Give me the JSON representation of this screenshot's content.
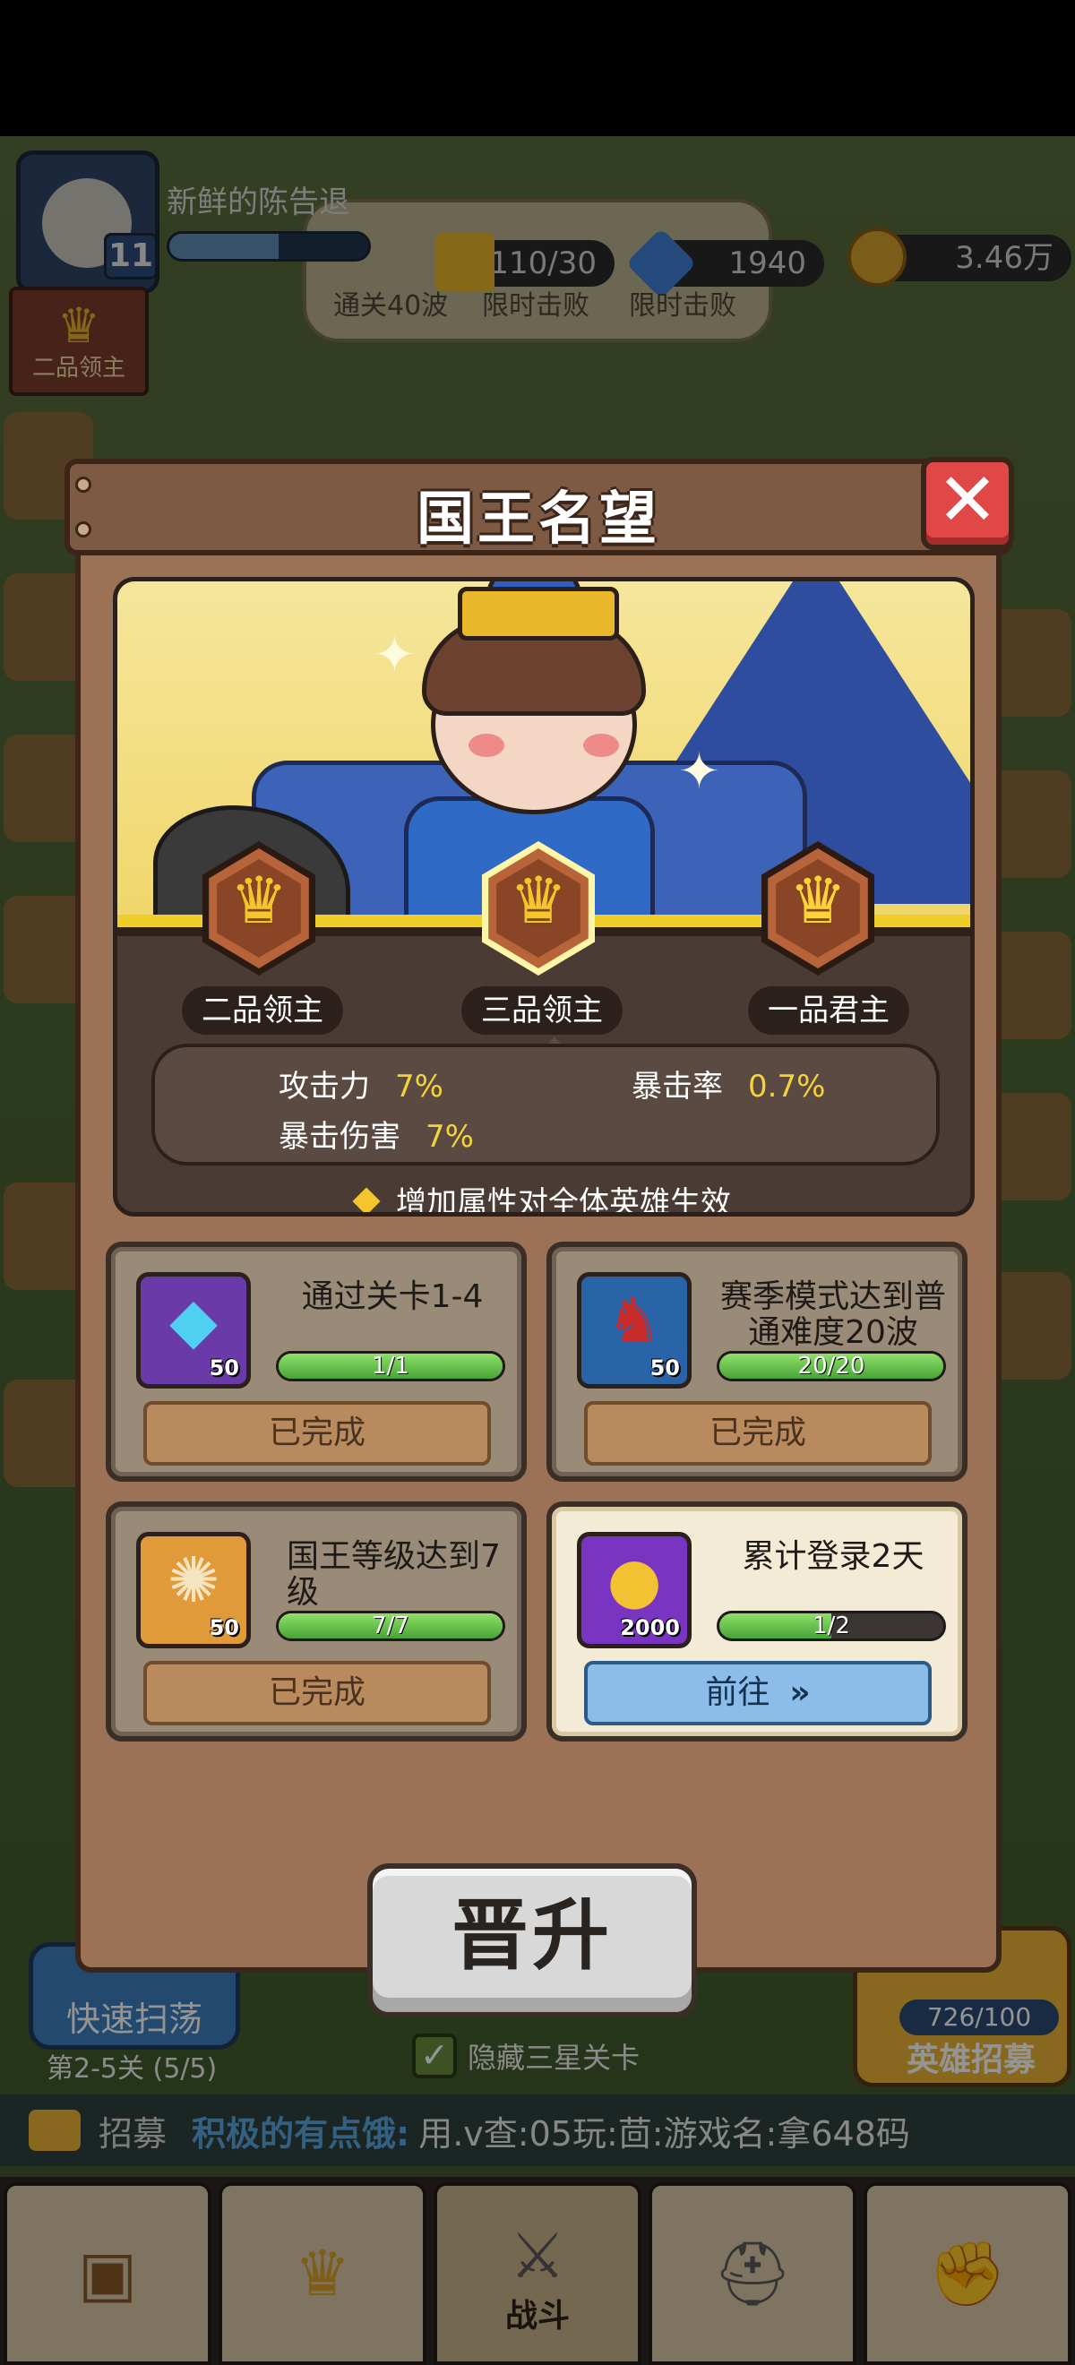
{
  "hud": {
    "player_name": "新鲜的陈告退",
    "level": "11",
    "xp_fraction": 0.55,
    "rank_badge": "二品领主",
    "energy": "110/30",
    "gems": "1940",
    "gold": "3.46万"
  },
  "quests": {
    "items": [
      "通关40波",
      "限时击败",
      "限时击败"
    ]
  },
  "modal": {
    "title": "国王名望",
    "close_symbol": "✕",
    "ranks": [
      {
        "label": "二品领主",
        "active": false
      },
      {
        "label": "三品领主",
        "active": true
      },
      {
        "label": "一品君主",
        "active": false
      }
    ],
    "stats": [
      {
        "key": "攻击力",
        "value": "7%"
      },
      {
        "key": "暴击率",
        "value": "0.7%"
      },
      {
        "key": "暴击伤害",
        "value": "7%"
      }
    ],
    "note": "增加属性对全体英雄生效",
    "tasks": [
      {
        "title": "通过关卡1-4",
        "reward_qty": "50",
        "progress_text": "1/1",
        "progress": 1.0,
        "button": "已完成",
        "state": "done",
        "icon": "gem-icon"
      },
      {
        "title": "赛季模式达到普通难度20波",
        "reward_qty": "50",
        "progress_text": "20/20",
        "progress": 1.0,
        "button": "已完成",
        "state": "done",
        "icon": "devil-icon"
      },
      {
        "title": "国王等级达到7级",
        "reward_qty": "50",
        "progress_text": "7/7",
        "progress": 1.0,
        "button": "已完成",
        "state": "done",
        "icon": "gear-medal-icon"
      },
      {
        "title": "累计登录2天",
        "reward_qty": "2000",
        "progress_text": "1/2",
        "progress": 0.5,
        "button": "前往",
        "state": "go",
        "icon": "gold-coin-icon"
      }
    ],
    "promote_label": "晋升"
  },
  "background": {
    "quick_sweep": "快速扫荡",
    "stage_label": "第2-5关 (5/5)",
    "hide_three_star": "隐藏三星关卡",
    "recruit_count": "726/100",
    "recruit_label": "英雄招募",
    "chat_label": "招募",
    "chat_user": "积极的有点饿:",
    "chat_message": "用.v查:05玩:茴:游戏名:拿648码"
  },
  "nav": {
    "tabs": [
      {
        "name": "shop",
        "label": ""
      },
      {
        "name": "crown",
        "label": ""
      },
      {
        "name": "battle",
        "label": "战斗"
      },
      {
        "name": "helmet",
        "label": ""
      },
      {
        "name": "fist",
        "label": ""
      }
    ]
  },
  "colors": {
    "modal_wood": "#9c7256",
    "header_wood": "#7d5a44",
    "close_red": "#e04848",
    "stat_yellow": "#f4d23a",
    "progress_green": "#48a436",
    "go_blue": "#8bbde8"
  }
}
